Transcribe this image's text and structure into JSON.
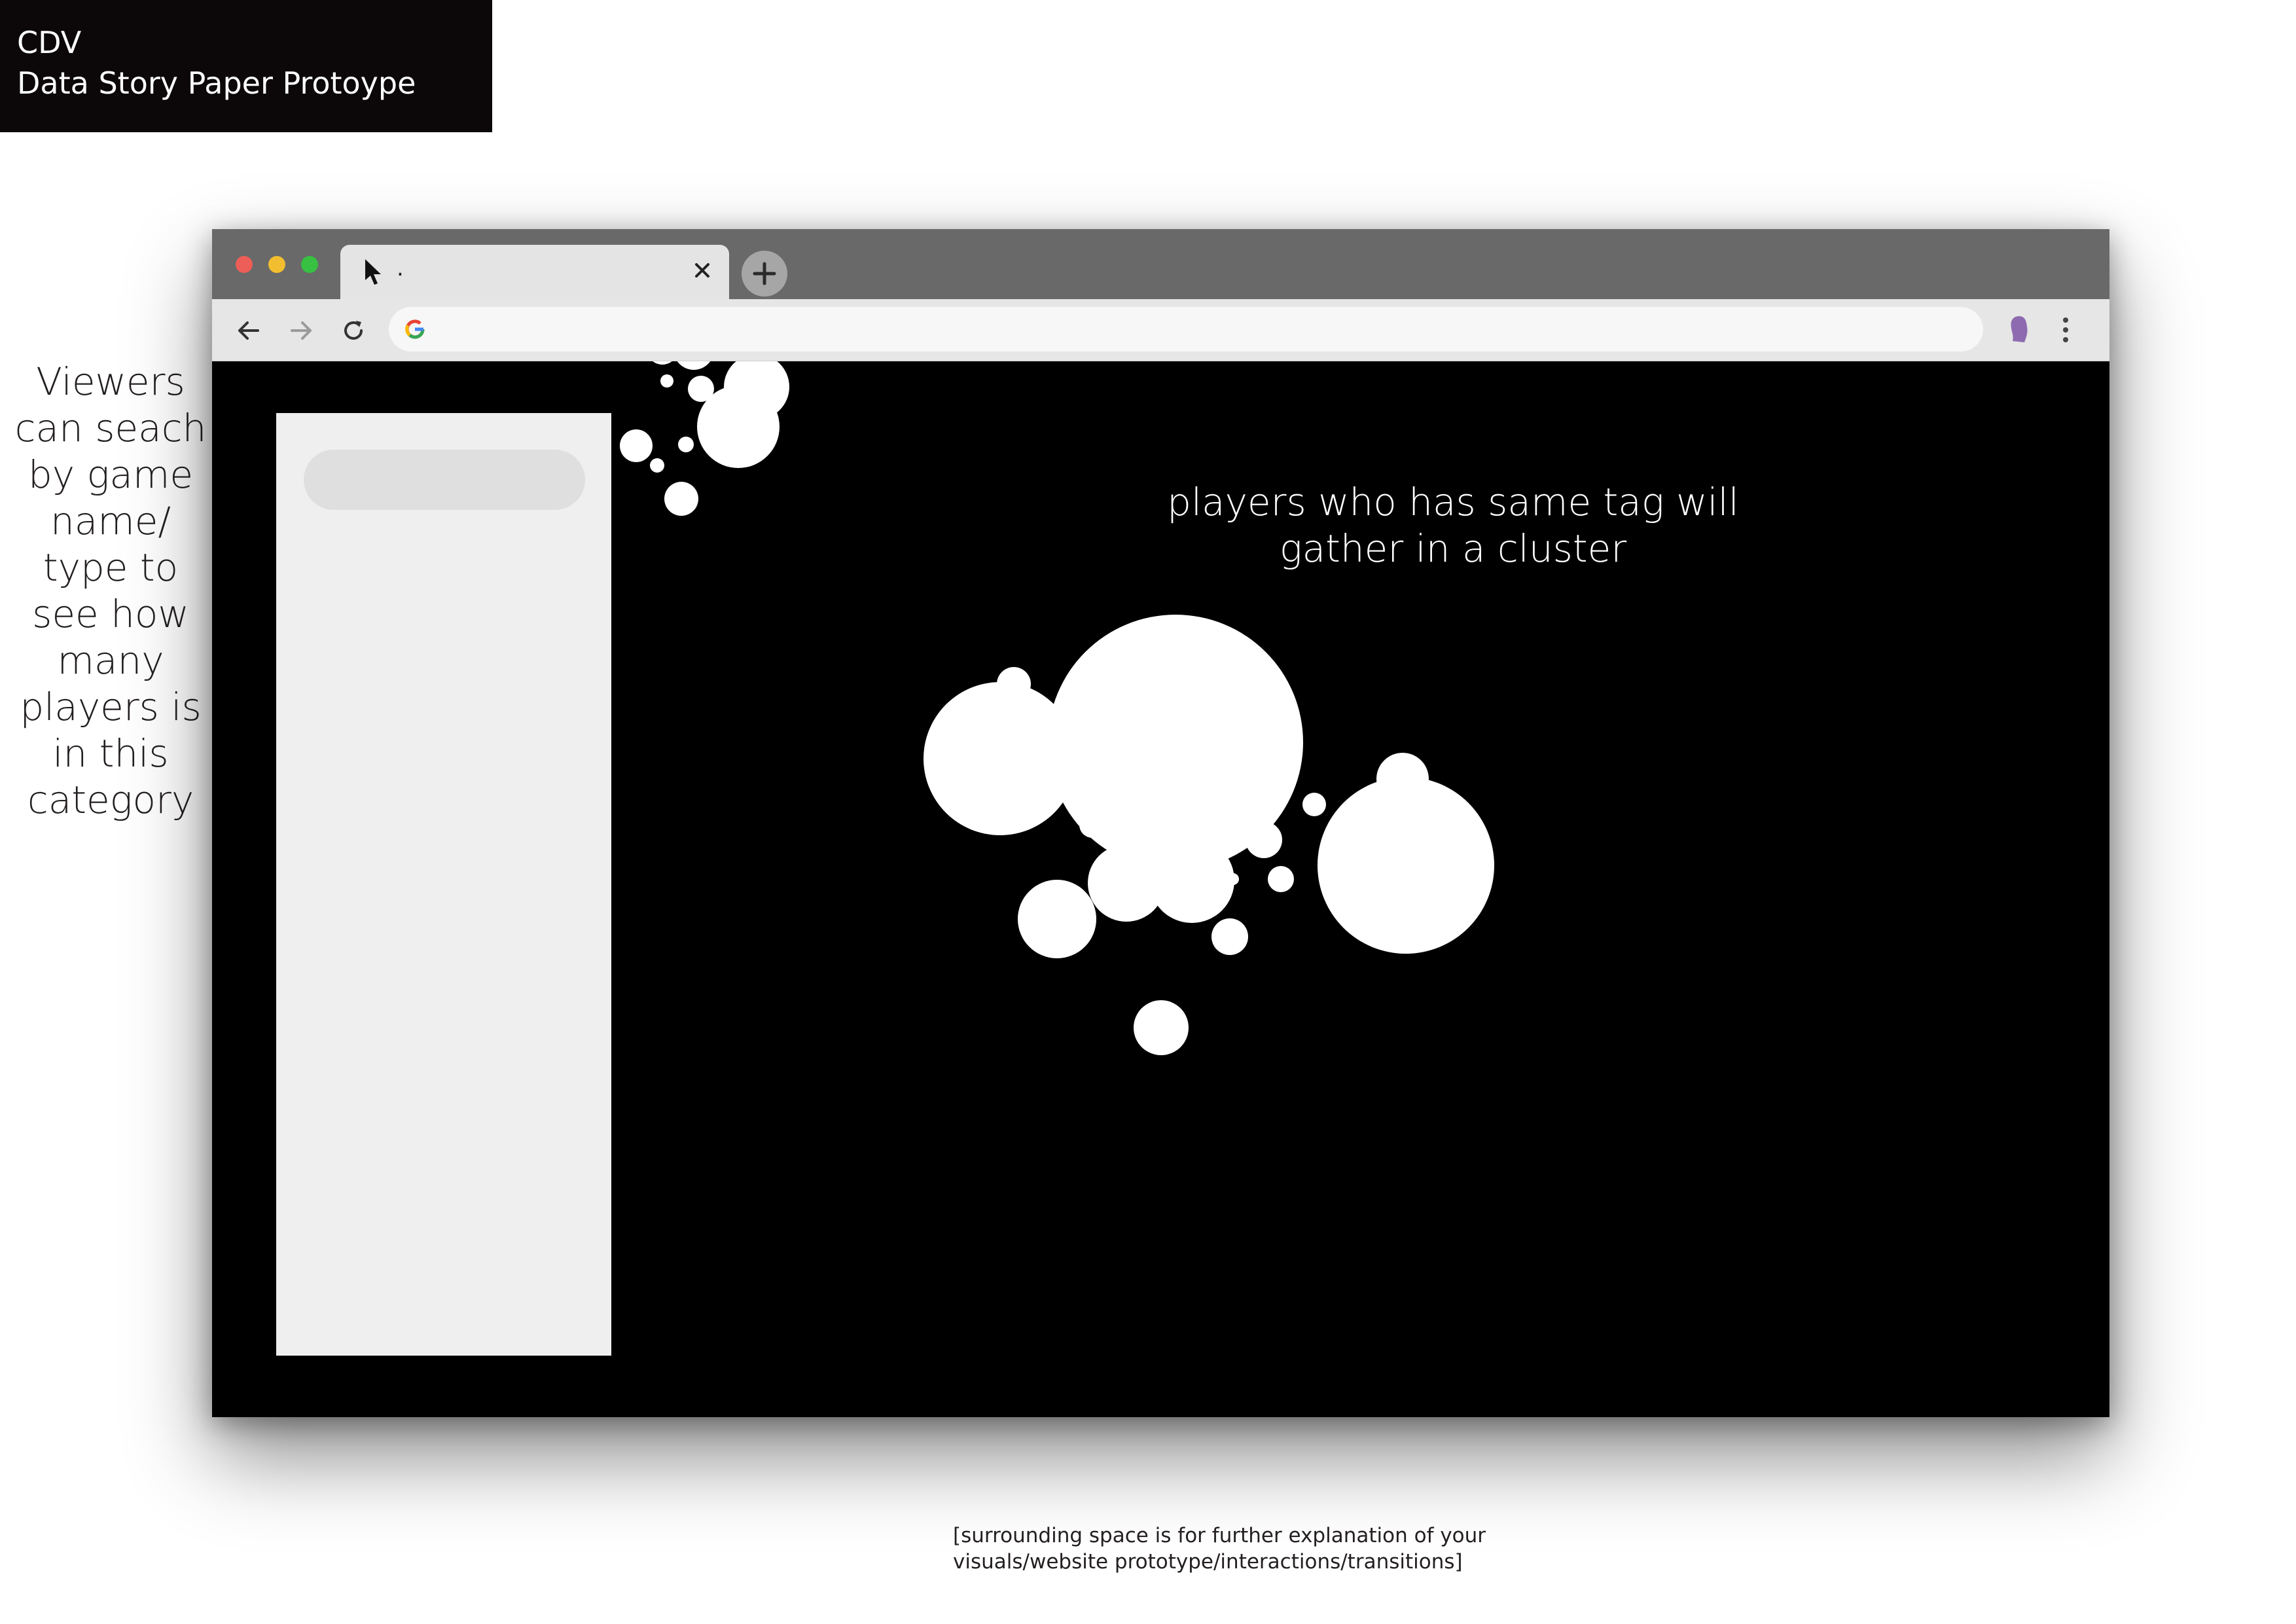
{
  "header": {
    "line1": "CDV",
    "line2": "Data Story Paper Protoype"
  },
  "side_note": {
    "text": "Viewers can seach by game name/ type to see how many players is in this category"
  },
  "browser": {
    "tab": {
      "title": ".",
      "cursor_icon": "cursor-arrow-icon",
      "close_icon": "close-icon"
    },
    "new_tab_icon": "plus-icon",
    "nav": {
      "back_icon": "back-arrow-icon",
      "forward_icon": "forward-arrow-icon",
      "reload_icon": "reload-icon"
    },
    "omnibox": {
      "value": "",
      "icon": "google-g-icon"
    },
    "profile_icon": "profile-avatar-icon",
    "menu_icon": "kebab-menu-icon",
    "colors": {
      "titlebar": "#686968",
      "toolbar": "#e5e6e5",
      "viewport": "#000000",
      "traffic_red": "#ec5e57",
      "traffic_yellow": "#f2bd2f",
      "traffic_green": "#37c041",
      "profile": "#8e6ab0"
    }
  },
  "page": {
    "side_panel": {
      "search_placeholder": ""
    },
    "caption": "players who has same tag will gather in a cluster",
    "bubble_color": "#ffffff"
  },
  "footer_note": {
    "line1": "[surrounding space is for further explanation of your",
    "line2": "visuals/website prototype/interactions/transitions]"
  }
}
